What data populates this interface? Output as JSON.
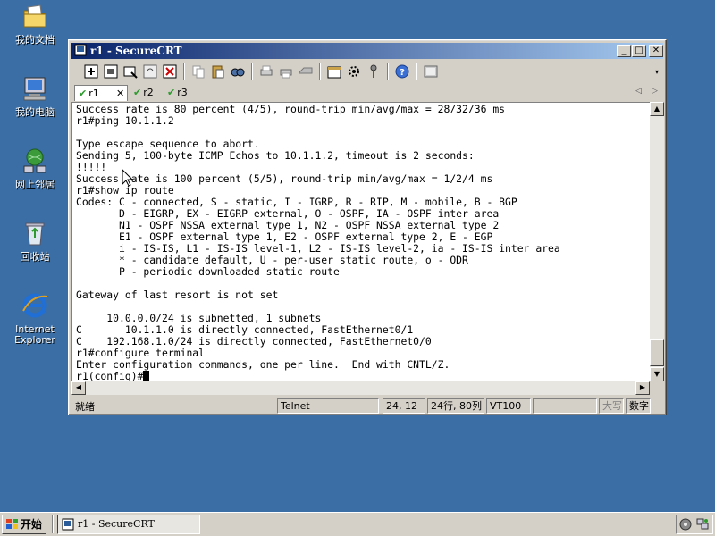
{
  "desktop": {
    "icons": [
      {
        "label": "我的文档",
        "icon": "folder-documents-icon"
      },
      {
        "label": "我的电脑",
        "icon": "computer-icon"
      },
      {
        "label": "网上邻居",
        "icon": "network-icon"
      },
      {
        "label": "回收站",
        "icon": "recycle-bin-icon"
      },
      {
        "label": "Internet\nExplorer",
        "icon": "internet-explorer-icon"
      }
    ]
  },
  "window": {
    "title": "r1 - SecureCRT",
    "controls": {
      "minimize": "_",
      "maximize": "□",
      "close": "✕"
    },
    "tabs": [
      {
        "label": "r1",
        "close": "✕",
        "active": true
      },
      {
        "label": "r2",
        "active": false
      },
      {
        "label": "r3",
        "active": false
      }
    ],
    "tab_nav": {
      "prev": "◁",
      "next": "▷"
    }
  },
  "terminal": {
    "lines": [
      "Success rate is 80 percent (4/5), round-trip min/avg/max = 28/32/36 ms",
      "r1#ping 10.1.1.2",
      "",
      "Type escape sequence to abort.",
      "Sending 5, 100-byte ICMP Echos to 10.1.1.2, timeout is 2 seconds:",
      "!!!!!",
      "Success rate is 100 percent (5/5), round-trip min/avg/max = 1/2/4 ms",
      "r1#show ip route",
      "Codes: C - connected, S - static, I - IGRP, R - RIP, M - mobile, B - BGP",
      "       D - EIGRP, EX - EIGRP external, O - OSPF, IA - OSPF inter area",
      "       N1 - OSPF NSSA external type 1, N2 - OSPF NSSA external type 2",
      "       E1 - OSPF external type 1, E2 - OSPF external type 2, E - EGP",
      "       i - IS-IS, L1 - IS-IS level-1, L2 - IS-IS level-2, ia - IS-IS inter area",
      "       * - candidate default, U - per-user static route, o - ODR",
      "       P - periodic downloaded static route",
      "",
      "Gateway of last resort is not set",
      "",
      "     10.0.0.0/24 is subnetted, 1 subnets",
      "C       10.1.1.0 is directly connected, FastEthernet0/1",
      "C    192.168.1.0/24 is directly connected, FastEthernet0/0",
      "r1#configure terminal",
      "Enter configuration commands, one per line.  End with CNTL/Z.",
      "r1(config)#"
    ]
  },
  "statusbar": {
    "ready": "就绪",
    "protocol": "Telnet",
    "cursor_pos": "24, 12",
    "rows_cols": "24行, 80列",
    "emulation": "VT100",
    "caps": "大写",
    "num": "数字"
  },
  "taskbar": {
    "start": "开始",
    "task": "r1 - SecureCRT"
  }
}
